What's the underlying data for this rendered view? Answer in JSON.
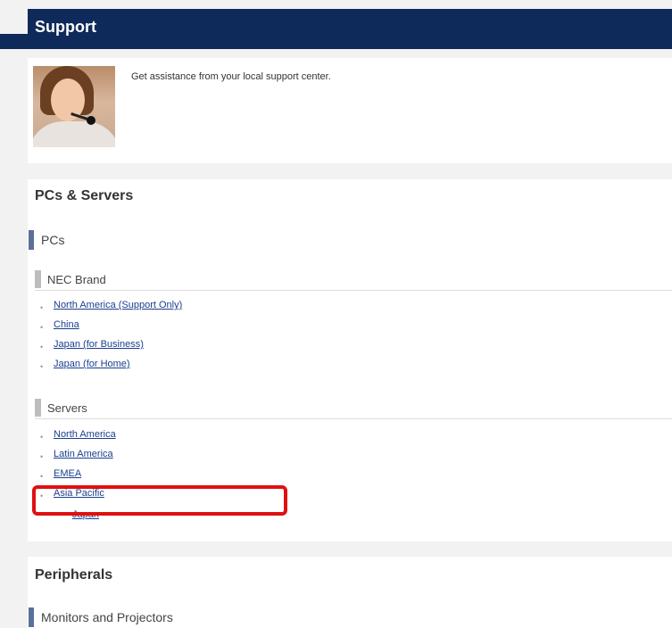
{
  "header": {
    "title": "Support"
  },
  "support": {
    "text": "Get assistance from your local support center."
  },
  "pcs_servers": {
    "title": "PCs & Servers",
    "category": "PCs",
    "nec_brand": {
      "label": "NEC Brand",
      "links": [
        "North America (Support Only)",
        "China",
        "Japan (for Business)",
        "Japan (for Home)"
      ]
    },
    "servers": {
      "label": "Servers",
      "links": [
        "North America",
        "Latin America",
        "EMEA",
        "Asia Pacific"
      ],
      "nested": [
        "Japan"
      ]
    }
  },
  "peripherals": {
    "title": "Peripherals",
    "category": "Monitors and Projectors"
  },
  "colors": {
    "header_bg": "#0e2a5a",
    "link": "#1a3f8f",
    "highlight": "#e01010",
    "category_accent": "#5a6f9a"
  }
}
